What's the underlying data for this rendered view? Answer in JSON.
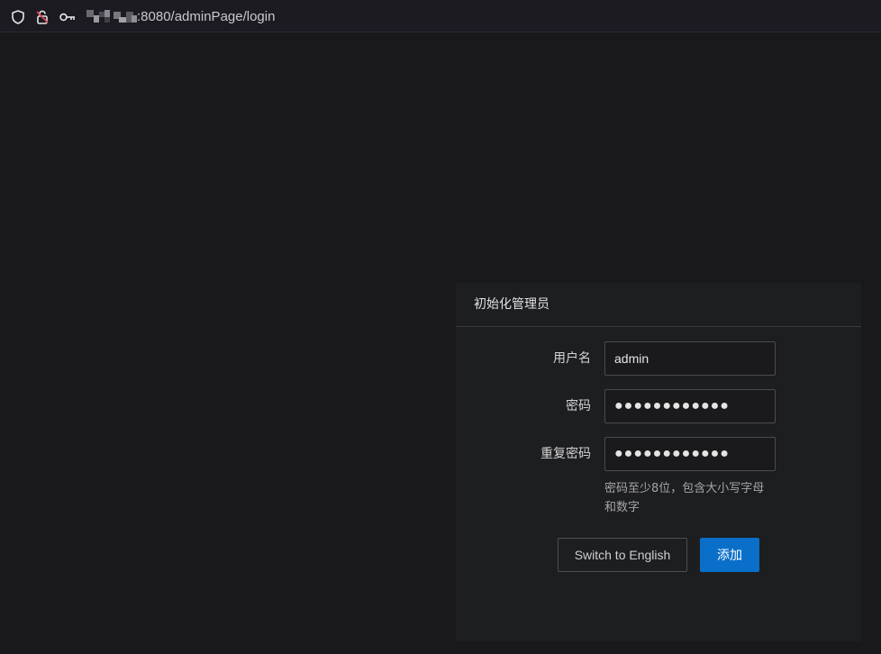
{
  "browser": {
    "url_visible": ":8080/adminPage/login",
    "icons": [
      "shield-icon",
      "lock-strike-icon",
      "key-icon"
    ]
  },
  "panel": {
    "title": "初始化管理员",
    "fields": [
      {
        "label": "用户名",
        "value": "admin",
        "type": "text"
      },
      {
        "label": "密码",
        "value": "●●●●●●●●●●●●",
        "type": "password"
      },
      {
        "label": "重复密码",
        "value": "●●●●●●●●●●●●",
        "type": "password"
      }
    ],
    "hint": "密码至少8位，包含大小写字母和数字",
    "buttons": {
      "switch_language": "Switch to English",
      "submit": "添加"
    }
  },
  "colors": {
    "background": "#19191b",
    "panel": "#1d1e20",
    "primary": "#0a6fc9",
    "lock_icon_accent": "#e0455a"
  }
}
